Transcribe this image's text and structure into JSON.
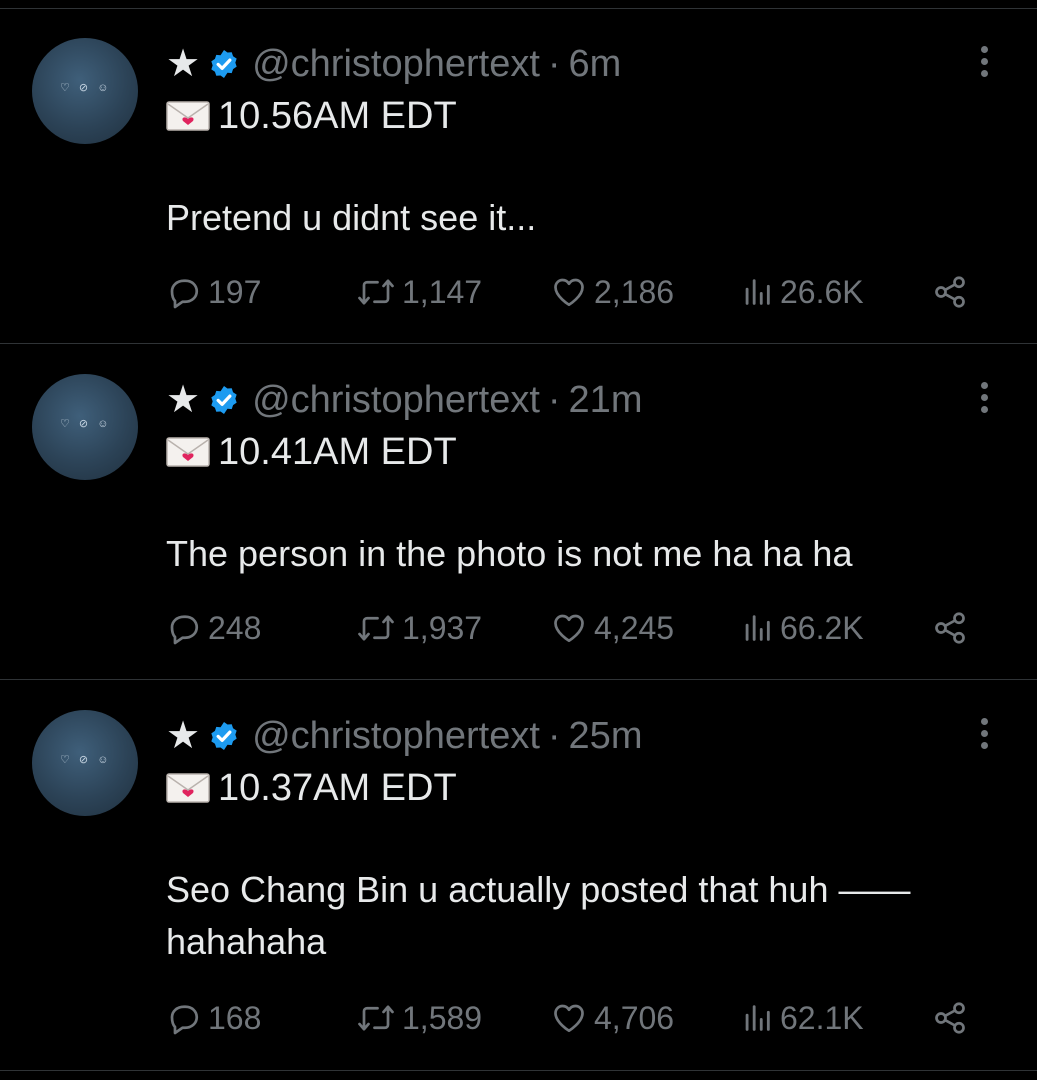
{
  "colors": {
    "background": "#000000",
    "primary_text": "#e7e9ea",
    "secondary_text": "#71767b",
    "verified_blue": "#1d9bf0",
    "divider": "#2f3336"
  },
  "tweets": [
    {
      "star": "★",
      "handle": "@christophertext",
      "separator": "·",
      "age": "6m",
      "time_line": "10.56AM EDT",
      "text": "Pretend u didnt see it...",
      "replies": "197",
      "retweets": "1,147",
      "likes": "2,186",
      "views": "26.6K"
    },
    {
      "star": "★",
      "handle": "@christophertext",
      "separator": "·",
      "age": "21m",
      "time_line": "10.41AM EDT",
      "text": "The person in the photo is not me ha ha ha",
      "replies": "248",
      "retweets": "1,937",
      "likes": "4,245",
      "views": "66.2K"
    },
    {
      "star": "★",
      "handle": "@christophertext",
      "separator": "·",
      "age": "25m",
      "time_line": "10.37AM EDT",
      "text": "Seo Chang Bin u actually posted that huh —— hahahaha",
      "replies": "168",
      "retweets": "1,589",
      "likes": "4,706",
      "views": "62.1K"
    }
  ],
  "icons": {
    "verified": "verified-badge-icon",
    "envelope": "love-letter-icon",
    "more": "more-options-icon",
    "reply": "reply-icon",
    "retweet": "retweet-icon",
    "like": "heart-icon",
    "views": "views-icon",
    "share": "share-icon"
  }
}
